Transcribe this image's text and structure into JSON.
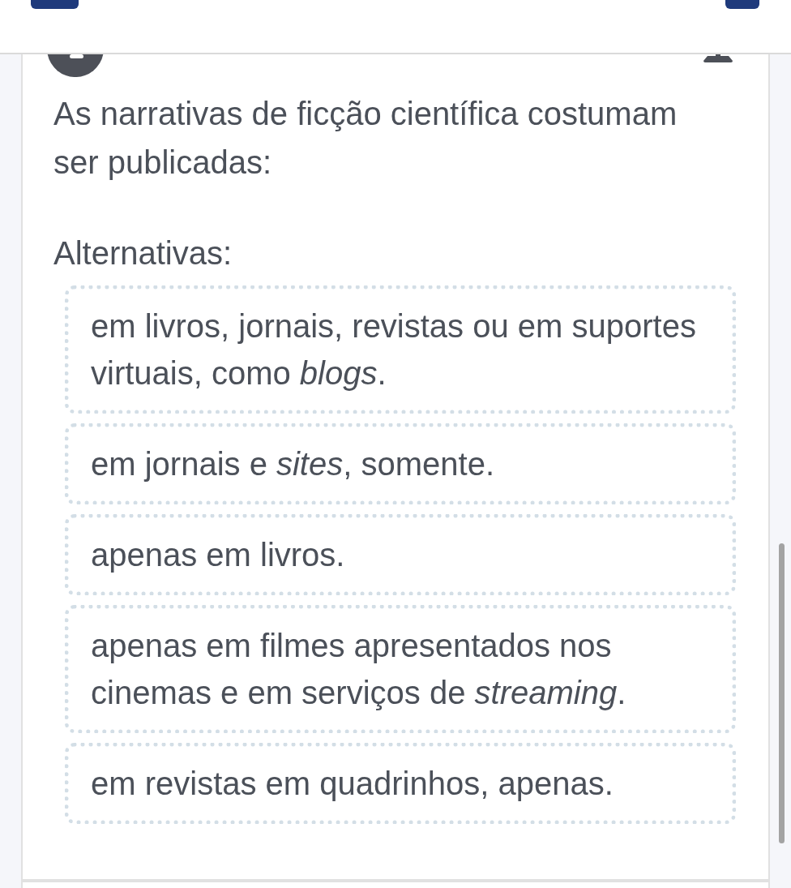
{
  "question": {
    "text": "As narrativas de ficção científica costumam ser publicadas:"
  },
  "alternatives": {
    "heading": "Alternativas:",
    "options": [
      {
        "text": "em livros, jornais, revistas ou em suportes virtuais, como *blogs*.",
        "selected": false
      },
      {
        "text": "em jornais e *sites*, somente.",
        "selected": false
      },
      {
        "text": "apenas em livros.",
        "selected": false
      },
      {
        "text": "apenas em filmes apresentados nos cinemas e em serviços de *streaming*.",
        "selected": false
      },
      {
        "text": "em revistas em quadrinhos, apenas.",
        "selected": false
      }
    ]
  }
}
